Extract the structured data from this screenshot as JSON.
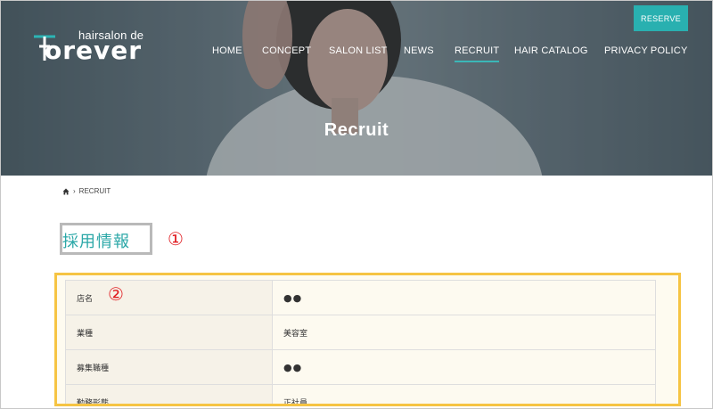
{
  "header": {
    "logo_small": "hairsalon de",
    "logo_big": "orever",
    "nav": [
      {
        "label": "HOME",
        "active": false
      },
      {
        "label": "CONCEPT",
        "active": false
      },
      {
        "label": "SALON LIST",
        "active": false
      },
      {
        "label": "NEWS",
        "active": false
      },
      {
        "label": "RECRUIT",
        "active": true
      },
      {
        "label": "HAIR CATALOG",
        "active": false
      },
      {
        "label": "PRIVACY POLICY",
        "active": false
      }
    ],
    "reserve_label": "RESERVE"
  },
  "hero": {
    "title": "Recruit"
  },
  "breadcrumb": {
    "current": "RECRUIT"
  },
  "section": {
    "heading": "採用情報"
  },
  "annotations": [
    "①",
    "②"
  ],
  "table": {
    "rows": [
      {
        "label": "店名",
        "value": "●●"
      },
      {
        "label": "業種",
        "value": "美容室"
      },
      {
        "label": "募集職種",
        "value": "●●"
      },
      {
        "label": "勤務形態",
        "value": "正社員"
      }
    ]
  },
  "colors": {
    "accent": "#29b0b0",
    "annotation": "#e0191e",
    "highlight_border": "#f6c443"
  }
}
